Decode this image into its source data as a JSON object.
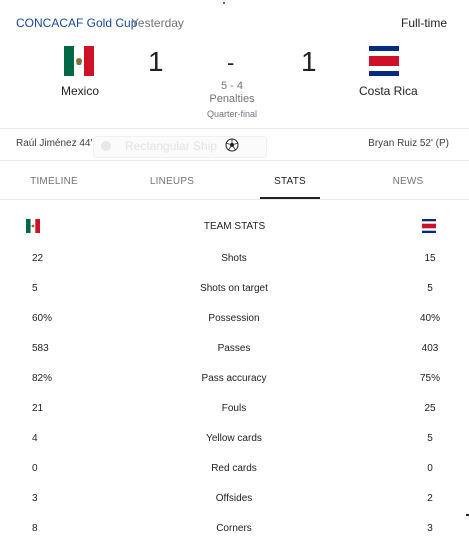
{
  "header": {
    "competition": "CONCACAF Gold Cup",
    "separator": "·",
    "when": "Yesterday",
    "status": "Full-time"
  },
  "match": {
    "home": {
      "name": "Mexico",
      "score": "1",
      "flag_icon": "mexico-flag-icon"
    },
    "away": {
      "name": "Costa Rica",
      "score": "1",
      "flag_icon": "costa-rica-flag-icon"
    },
    "dash": "-",
    "penalties_score": "5 - 4",
    "penalties_label": "Penalties",
    "round": "Quarter-final"
  },
  "scorers": {
    "home": "Raúl Jiménez 44'",
    "away": "Bryan Ruiz 52' (P)",
    "ball_icon": "soccer-ball-icon"
  },
  "ad": {
    "text": "Rectangular Ship"
  },
  "tabs": [
    {
      "label": "TIMELINE",
      "active": false
    },
    {
      "label": "LINEUPS",
      "active": false
    },
    {
      "label": "STATS",
      "active": true
    },
    {
      "label": "NEWS",
      "active": false
    }
  ],
  "stats": {
    "heading": "TEAM STATS",
    "rows": [
      {
        "home": "22",
        "label": "Shots",
        "away": "15"
      },
      {
        "home": "5",
        "label": "Shots on target",
        "away": "5"
      },
      {
        "home": "60%",
        "label": "Possession",
        "away": "40%"
      },
      {
        "home": "583",
        "label": "Passes",
        "away": "403"
      },
      {
        "home": "82%",
        "label": "Pass accuracy",
        "away": "75%"
      },
      {
        "home": "21",
        "label": "Fouls",
        "away": "25"
      },
      {
        "home": "4",
        "label": "Yellow cards",
        "away": "5"
      },
      {
        "home": "0",
        "label": "Red cards",
        "away": "0"
      },
      {
        "home": "3",
        "label": "Offsides",
        "away": "2"
      },
      {
        "home": "8",
        "label": "Corners",
        "away": "3"
      }
    ]
  },
  "colors": {
    "link": "#1a4a9c",
    "muted": "#70757a",
    "mexico_green": "#006847",
    "mexico_red": "#ce1126",
    "costa_rica_blue": "#002b7f",
    "costa_rica_red": "#ce1126"
  }
}
